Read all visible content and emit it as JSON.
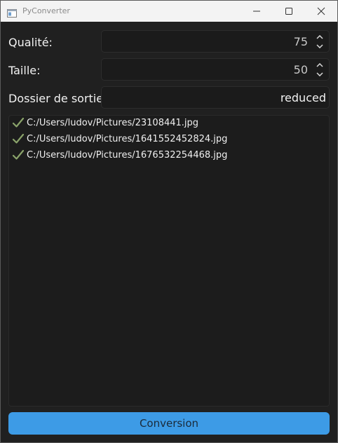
{
  "window": {
    "title": "PyConverter"
  },
  "form": {
    "quality_label": "Qualité:",
    "quality_value": "75",
    "size_label": "Taille:",
    "size_value": "50",
    "output_label": "Dossier de sortie:",
    "output_value": "reduced"
  },
  "files": [
    {
      "status_icon": "check-icon",
      "path": "C:/Users/ludov/Pictures/23108441.jpg"
    },
    {
      "status_icon": "check-icon",
      "path": "C:/Users/ludov/Pictures/1641552452824.jpg"
    },
    {
      "status_icon": "check-icon",
      "path": "C:/Users/ludov/Pictures/1676532254468.jpg"
    }
  ],
  "actions": {
    "convert_label": "Conversion"
  },
  "colors": {
    "accent": "#3d9be6",
    "check": "#8aa36a",
    "background": "#202020"
  }
}
